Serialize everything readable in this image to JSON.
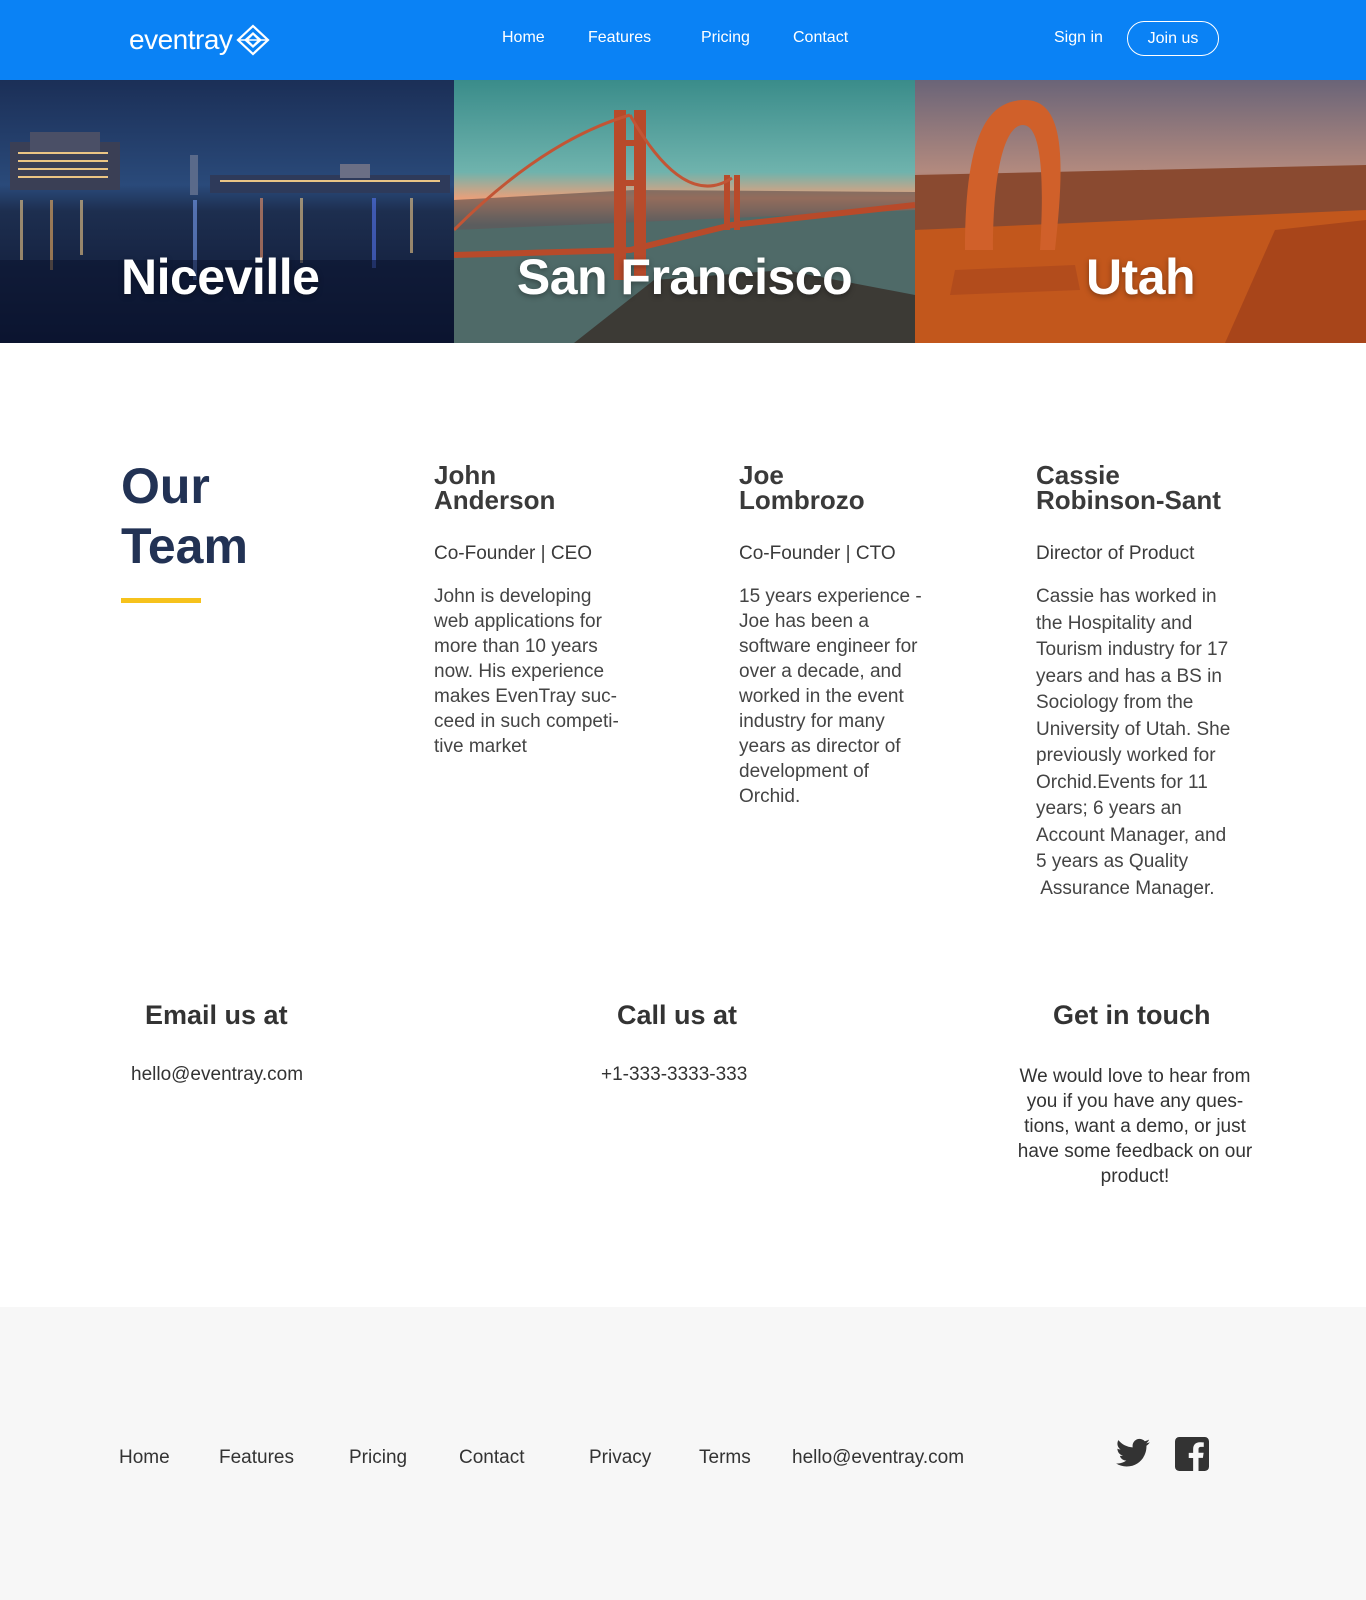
{
  "nav": {
    "logo_text": "eventray",
    "links": [
      "Home",
      "Features",
      "Pricing",
      "Contact"
    ],
    "sign_in": "Sign in",
    "join": "Join us"
  },
  "hero": {
    "cities": [
      "Niceville",
      "San Francisco",
      "Utah"
    ]
  },
  "team": {
    "title_line1": "Our",
    "title_line2": "Team",
    "accent_color": "#f6c21c",
    "members": [
      {
        "first": "John",
        "last": "Anderson",
        "role": "Co-Founder | CEO",
        "bio": [
          "John is developing",
          "web applications for",
          "more than 10 years",
          "now. His experience",
          "makes EvenTray suc-",
          "ceed in such competi-",
          "tive market"
        ]
      },
      {
        "first": "Joe",
        "last": "Lombrozo",
        "role": "Co-Founder | CTO",
        "bio": [
          "15 years experience -",
          "Joe has been a",
          "software engineer for",
          "over a decade, and",
          "worked in the event",
          "industry for many",
          "years as director of",
          "development of",
          "Orchid."
        ]
      },
      {
        "first": "Cassie",
        "last": "Robinson-Sant",
        "role": "Director of Product",
        "bio": [
          "Cassie has worked in",
          "the Hospitality and",
          "Tourism industry for 17",
          "years and has a BS in",
          "Sociology from the",
          "University of Utah. She",
          "previously worked for",
          "Orchid.Events for 11",
          "years; 6 years an",
          "Account Manager, and",
          "5 years as Quality",
          " Assurance Manager."
        ]
      }
    ]
  },
  "contact": {
    "email_heading": "Email us at",
    "email": "hello@eventray.com",
    "call_heading": "Call us at",
    "phone": "+1-333-3333-333",
    "touch_heading": "Get in touch",
    "touch_text": [
      "We would love to hear from",
      "you if you have any ques-",
      "tions, want a demo, or just",
      "have some feedback on our",
      "product!"
    ]
  },
  "footer": {
    "links": [
      "Home",
      "Features",
      "Pricing",
      "Contact",
      "Privacy",
      "Terms"
    ],
    "email": "hello@eventray.com",
    "social_icons": [
      "twitter-icon",
      "facebook-icon"
    ]
  },
  "colors": {
    "nav_bg": "#0a82f5",
    "heading_navy": "#223254",
    "footer_bg": "#f7f7f7"
  }
}
